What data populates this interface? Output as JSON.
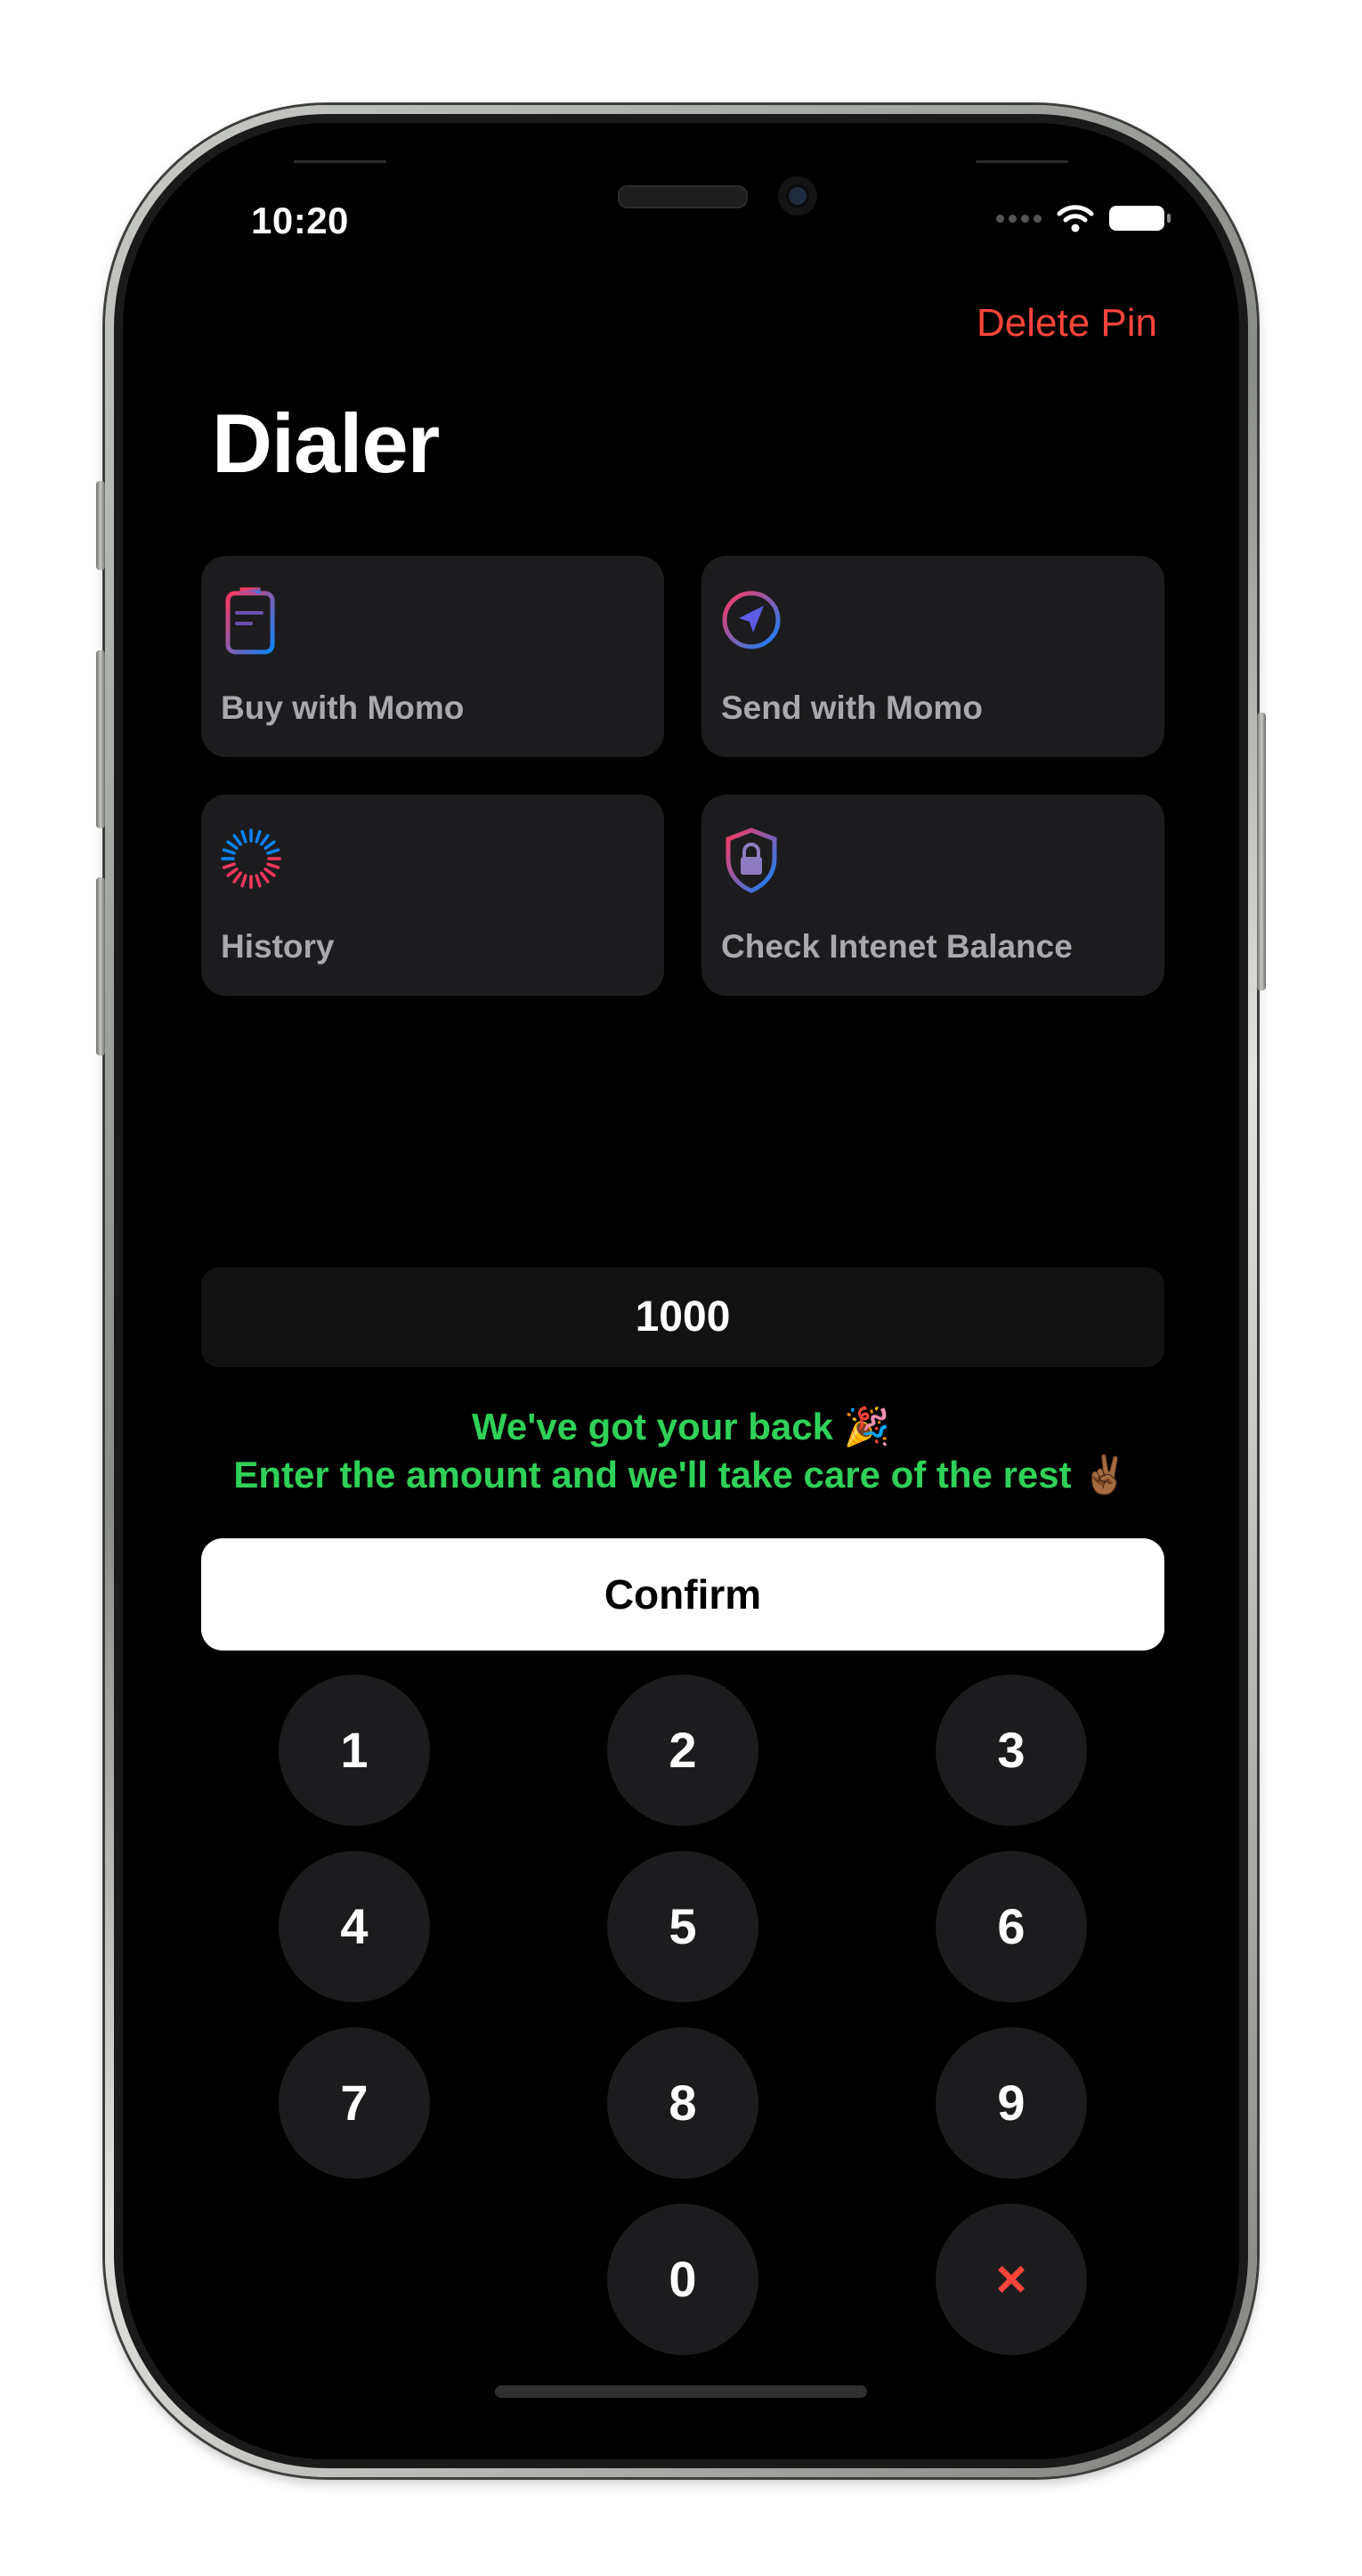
{
  "status_bar": {
    "time": "10:20"
  },
  "header": {
    "delete_pin": "Delete Pin",
    "title": "Dialer"
  },
  "cards": [
    {
      "label": "Buy with Momo",
      "icon": "receipt-icon"
    },
    {
      "label": "Send with Momo",
      "icon": "send-icon"
    },
    {
      "label": "History",
      "icon": "history-spinner-icon"
    },
    {
      "label": "Check Intenet Balance",
      "icon": "shield-lock-icon"
    }
  ],
  "amount": {
    "value": "1000"
  },
  "messages": {
    "line1": "We've got your back 🎉",
    "line2": "Enter the amount and we'll take care of the rest ✌🏾"
  },
  "confirm_label": "Confirm",
  "keypad": {
    "k1": "1",
    "k2": "2",
    "k3": "3",
    "k4": "4",
    "k5": "5",
    "k6": "6",
    "k7": "7",
    "k8": "8",
    "k9": "9",
    "k0": "0",
    "delete": "×"
  },
  "colors": {
    "accent_red": "#ff453a",
    "message_green": "#30d158",
    "card_bg": "#1c1c1e"
  }
}
